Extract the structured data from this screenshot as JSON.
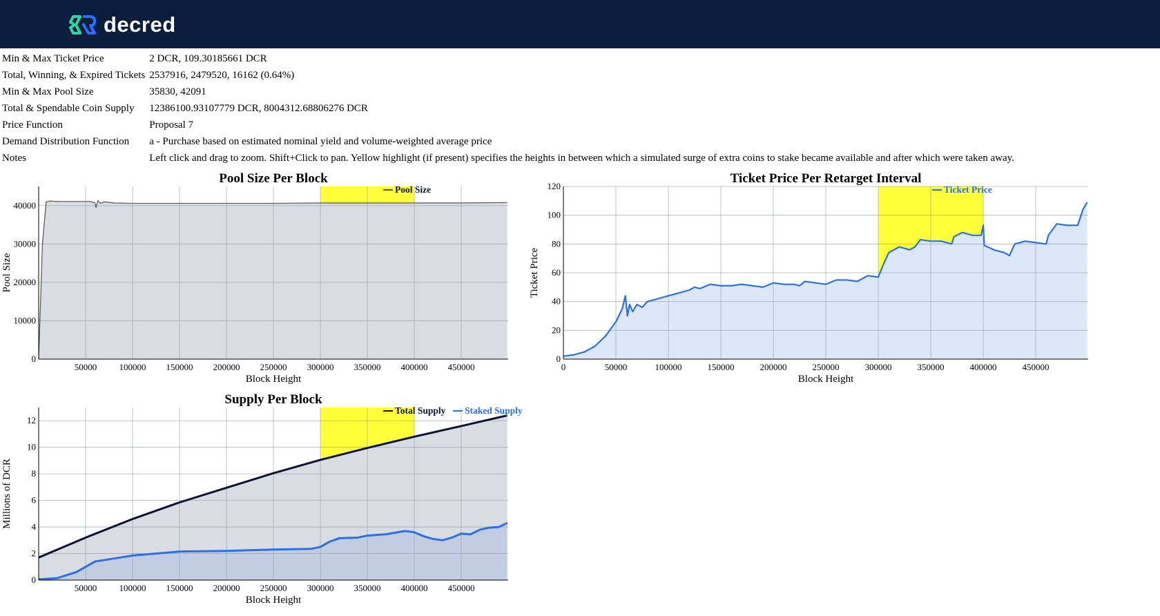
{
  "header": {
    "brand": "decred"
  },
  "info": [
    {
      "label": "Min & Max Ticket Price",
      "value": "2 DCR, 109.30185661 DCR"
    },
    {
      "label": "Total, Winning, & Expired Tickets",
      "value": "2537916, 2479520, 16162 (0.64%)"
    },
    {
      "label": "Min & Max Pool Size",
      "value": "35830, 42091"
    },
    {
      "label": "Total & Spendable Coin Supply",
      "value": "12386100.93107779 DCR, 8004312.68806276 DCR"
    },
    {
      "label": "Price Function",
      "value": "Proposal 7"
    },
    {
      "label": "Demand Distribution Function",
      "value": "a - Purchase based on estimated nominal yield and volume-weighted average price"
    },
    {
      "label": "Notes",
      "value": "Left click and drag to zoom. Shift+Click to pan. Yellow highlight (if present) specifies the heights in between which a simulated surge of extra coins to stake became available and after which were taken away."
    }
  ],
  "colors": {
    "header_bg": "#0c1e3e",
    "highlight": "#ffff3a",
    "grey_fill": "#d9dce1",
    "blue_line": "#2b70e6",
    "blue_fill": "#dce8f8",
    "dark_line": "#0d1433",
    "staked_fill": "#c2cde3"
  },
  "chart_data": [
    {
      "id": "pool",
      "type": "area",
      "title": "Pool Size Per Block",
      "xlabel": "Block Height",
      "ylabel": "Pool Size",
      "xlim": [
        0,
        500000
      ],
      "ylim": [
        0,
        45000
      ],
      "xticks": [
        50000,
        100000,
        150000,
        200000,
        250000,
        300000,
        350000,
        400000,
        450000
      ],
      "yticks": [
        0,
        10000,
        20000,
        30000,
        40000
      ],
      "highlight": [
        300000,
        400000
      ],
      "legend": "top-right",
      "series": [
        {
          "name": "Pool Size",
          "x": [
            0,
            4000,
            8000,
            12000,
            20000,
            40000,
            55000,
            60000,
            61000,
            63000,
            66000,
            70000,
            80000,
            100000,
            150000,
            200000,
            250000,
            300000,
            350000,
            400000,
            450000,
            499000
          ],
          "y": [
            0,
            30000,
            41000,
            41200,
            41100,
            41100,
            41100,
            40700,
            39500,
            41300,
            40600,
            41000,
            40700,
            40600,
            40600,
            40600,
            40600,
            40700,
            40700,
            40700,
            40700,
            40800
          ]
        }
      ]
    },
    {
      "id": "price",
      "type": "area",
      "title": "Ticket Price Per Retarget Interval",
      "xlabel": "Block Height",
      "ylabel": "Ticket Price",
      "xlim": [
        0,
        500000
      ],
      "ylim": [
        0,
        120
      ],
      "xticks": [
        0,
        50000,
        100000,
        150000,
        200000,
        250000,
        300000,
        350000,
        400000,
        450000
      ],
      "yticks": [
        0,
        20,
        40,
        60,
        80,
        100,
        120
      ],
      "highlight": [
        300000,
        400000
      ],
      "legend": "top-right",
      "series": [
        {
          "name": "Ticket Price",
          "x": [
            0,
            10000,
            20000,
            30000,
            40000,
            50000,
            56000,
            59000,
            61000,
            63000,
            66000,
            70000,
            75000,
            80000,
            90000,
            100000,
            110000,
            120000,
            125000,
            130000,
            140000,
            150000,
            160000,
            170000,
            180000,
            190000,
            200000,
            210000,
            220000,
            225000,
            230000,
            240000,
            250000,
            260000,
            270000,
            280000,
            290000,
            300000,
            305000,
            310000,
            320000,
            330000,
            335000,
            340000,
            350000,
            360000,
            370000,
            372000,
            380000,
            390000,
            398000,
            400000,
            401000,
            410000,
            420000,
            425000,
            430000,
            440000,
            450000,
            460000,
            462000,
            470000,
            480000,
            490000,
            495000,
            499000
          ],
          "y": [
            2,
            3,
            5,
            9,
            16,
            26,
            35,
            44,
            30,
            38,
            33,
            38,
            36,
            40,
            42,
            44,
            46,
            48,
            50,
            49,
            52,
            51,
            51,
            52,
            51,
            50,
            53,
            52,
            52,
            51,
            54,
            53,
            52,
            55,
            55,
            54,
            58,
            57,
            66,
            74,
            78,
            76,
            78,
            83,
            82,
            82,
            80,
            85,
            88,
            86,
            86,
            93,
            79,
            76,
            74,
            72,
            80,
            82,
            81,
            80,
            86,
            94,
            93,
            93,
            104,
            109
          ]
        }
      ]
    },
    {
      "id": "supply",
      "type": "area",
      "title": "Supply Per Block",
      "xlabel": "Block Height",
      "ylabel": "Millions of DCR",
      "xlim": [
        0,
        500000
      ],
      "ylim": [
        0,
        13
      ],
      "xticks": [
        50000,
        100000,
        150000,
        200000,
        250000,
        300000,
        350000,
        400000,
        450000
      ],
      "yticks": [
        0,
        2,
        4,
        6,
        8,
        10,
        12
      ],
      "highlight": [
        300000,
        400000
      ],
      "legend": "top-right",
      "series": [
        {
          "name": "Total Supply",
          "x": [
            0,
            50000,
            100000,
            150000,
            200000,
            250000,
            300000,
            350000,
            400000,
            450000,
            499000
          ],
          "y": [
            1.7,
            3.2,
            4.6,
            5.85,
            6.95,
            8.05,
            9.05,
            9.95,
            10.8,
            11.6,
            12.4
          ]
        },
        {
          "name": "Staked Supply",
          "x": [
            0,
            20000,
            40000,
            50000,
            60000,
            100000,
            150000,
            200000,
            250000,
            290000,
            300000,
            310000,
            320000,
            340000,
            350000,
            370000,
            390000,
            400000,
            410000,
            420000,
            430000,
            440000,
            450000,
            460000,
            470000,
            480000,
            490000,
            499000
          ],
          "y": [
            0.05,
            0.15,
            0.6,
            1.0,
            1.4,
            1.85,
            2.15,
            2.2,
            2.3,
            2.35,
            2.5,
            2.9,
            3.15,
            3.2,
            3.35,
            3.45,
            3.7,
            3.6,
            3.3,
            3.1,
            3.0,
            3.2,
            3.5,
            3.45,
            3.8,
            3.95,
            4.0,
            4.3
          ]
        }
      ]
    }
  ]
}
